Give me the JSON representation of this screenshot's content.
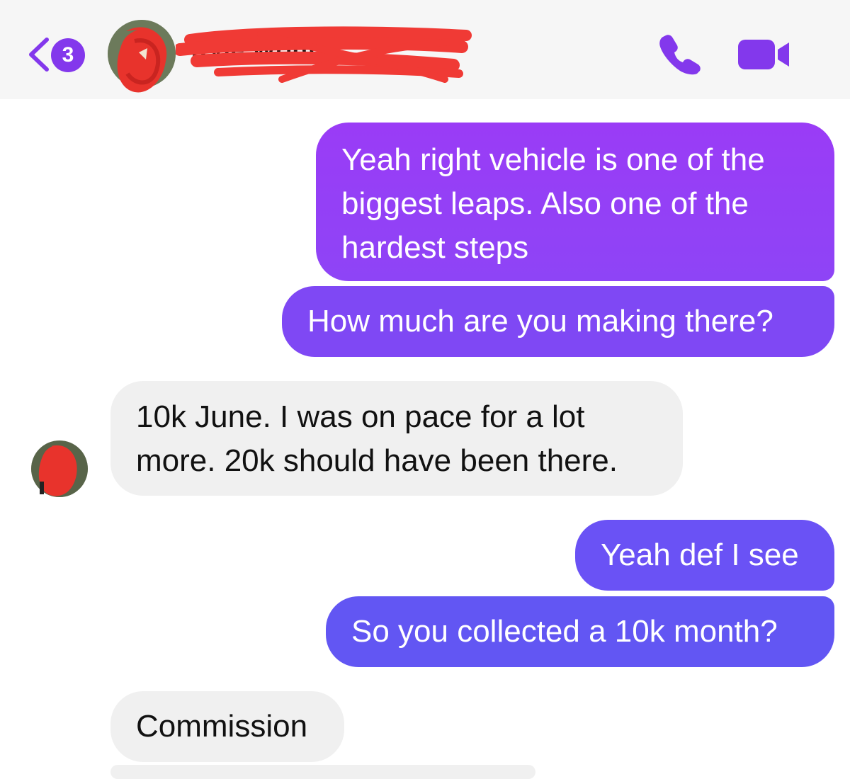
{
  "header": {
    "back_label": "Back",
    "unread_count": "3",
    "contact_name": "Kyle Wright",
    "back_icon": "chevron-left-icon",
    "call_icon": "phone-icon",
    "video_icon": "video-camera-icon"
  },
  "messages": [
    {
      "direction": "outgoing",
      "lines": [
        "Yeah right vehicle is one of the",
        "biggest leaps. Also one of the",
        "hardest steps"
      ]
    },
    {
      "direction": "outgoing",
      "lines": [
        "How much are you making there?"
      ]
    },
    {
      "direction": "incoming",
      "lines": [
        "10k June.  I was on pace for a lot",
        "more. 20k should have been there."
      ]
    },
    {
      "direction": "outgoing",
      "lines": [
        "Yeah def I see"
      ]
    },
    {
      "direction": "outgoing",
      "lines": [
        "So you collected a 10k month?"
      ]
    },
    {
      "direction": "incoming",
      "lines": [
        "Commission"
      ]
    }
  ],
  "colors": {
    "accent": "#8338ec",
    "header_background": "#f6f6f6",
    "incoming_bubble": "#f0f0f0",
    "redaction": "#f03a35"
  }
}
